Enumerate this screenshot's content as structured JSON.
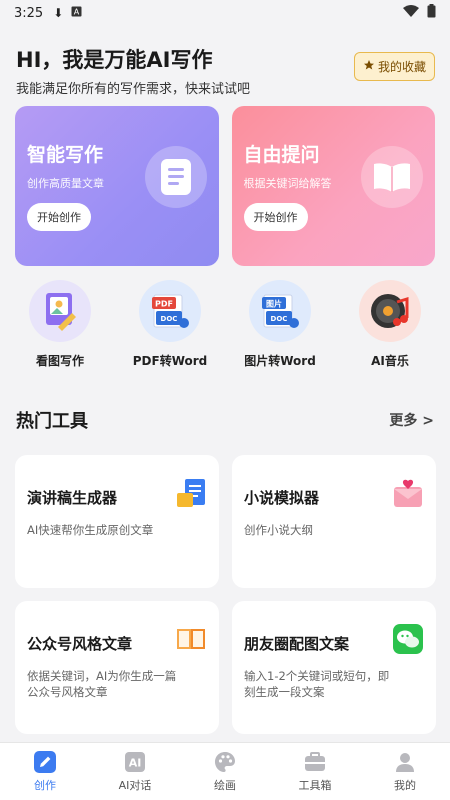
{
  "status": {
    "time": "3:25"
  },
  "header": {
    "title": "HI，我是万能AI写作",
    "subtitle": "我能满足你所有的写作需求，快来试试吧",
    "favorite_label": "我的收藏"
  },
  "cards": [
    {
      "title": "智能写作",
      "desc": "创作高质量文章",
      "cta": "开始创作"
    },
    {
      "title": "自由提问",
      "desc": "根据关键词给解答",
      "cta": "开始创作"
    }
  ],
  "tools": [
    {
      "label": "看图写作"
    },
    {
      "label": "PDF转Word"
    },
    {
      "label": "图片转Word"
    },
    {
      "label": "AI音乐"
    }
  ],
  "hot_tools": {
    "heading": "热门工具",
    "more": "更多 >",
    "items": [
      {
        "title": "演讲稿生成器",
        "desc": "AI快速帮你生成原创文章"
      },
      {
        "title": "小说模拟器",
        "desc": "创作小说大纲"
      },
      {
        "title": "公众号风格文章",
        "desc": "依据关键词，AI为你生成一篇公众号风格文章"
      },
      {
        "title": "朋友圈配图文案",
        "desc": "输入1-2个关键词或短句，即刻生成一段文案"
      }
    ]
  },
  "nav": [
    {
      "label": "创作"
    },
    {
      "label": "AI对话"
    },
    {
      "label": "绘画"
    },
    {
      "label": "工具箱"
    },
    {
      "label": "我的"
    }
  ],
  "colors": {
    "accent": "#3c7bf0",
    "purple_card": "#a897f5",
    "pink_card": "#fb9cb5",
    "fav_bg": "#fdf0cf"
  }
}
